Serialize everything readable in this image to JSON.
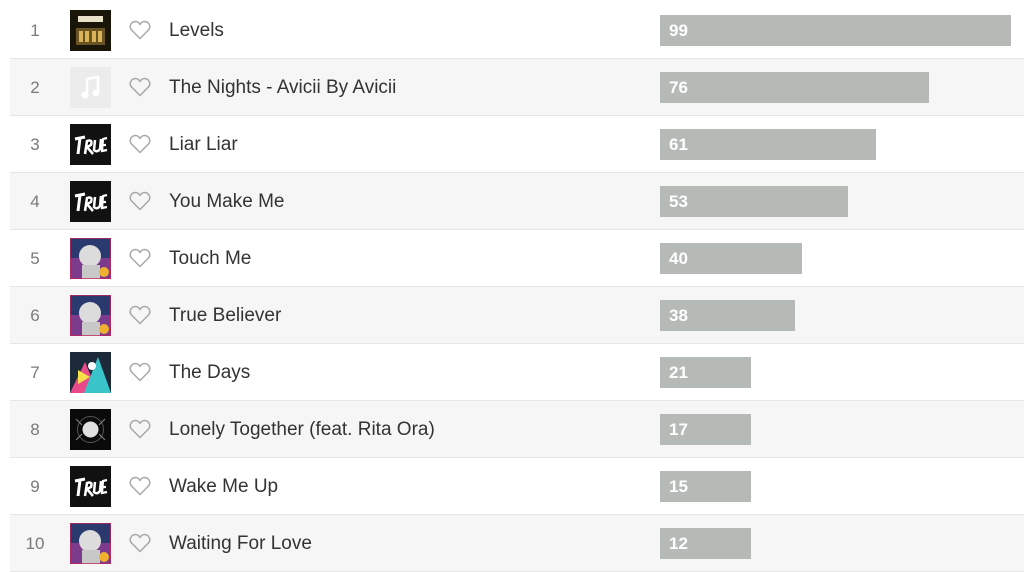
{
  "tracks": [
    {
      "rank": "1",
      "title": "Levels",
      "plays": "99",
      "art": "levels-cover"
    },
    {
      "rank": "2",
      "title": "The Nights - Avicii By Avicii",
      "plays": "76",
      "art": "music-note-placeholder"
    },
    {
      "rank": "3",
      "title": "Liar Liar",
      "plays": "61",
      "art": "true-cover"
    },
    {
      "rank": "4",
      "title": "You Make Me",
      "plays": "53",
      "art": "true-cover"
    },
    {
      "rank": "5",
      "title": "Touch Me",
      "plays": "40",
      "art": "stories-cover"
    },
    {
      "rank": "6",
      "title": "True Believer",
      "plays": "38",
      "art": "stories-cover"
    },
    {
      "rank": "7",
      "title": "The Days",
      "plays": "21",
      "art": "days-cover"
    },
    {
      "rank": "8",
      "title": "Lonely Together (feat. Rita Ora)",
      "plays": "17",
      "art": "avici-ep-cover"
    },
    {
      "rank": "9",
      "title": "Wake Me Up",
      "plays": "15",
      "art": "true-cover"
    },
    {
      "rank": "10",
      "title": "Waiting For Love",
      "plays": "12",
      "art": "stories-cover"
    }
  ],
  "max_plays": 99,
  "colors": {
    "bar": "#b6bab7",
    "bar_text": "#ffffff",
    "row_alt": "#f6f6f6"
  }
}
